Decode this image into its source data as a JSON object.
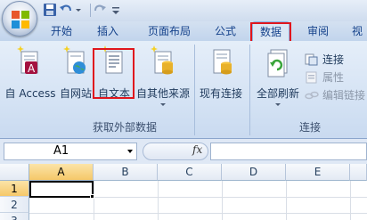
{
  "quick_access": {
    "save_icon": "save-icon",
    "undo_icon": "undo-icon",
    "redo_icon": "redo-icon",
    "customize_icon": "customize-qat-icon"
  },
  "tabs": [
    {
      "label": "开始"
    },
    {
      "label": "插入"
    },
    {
      "label": "页面布局"
    },
    {
      "label": "公式"
    },
    {
      "label": "数据",
      "active": true
    },
    {
      "label": "审阅"
    },
    {
      "label": "视"
    }
  ],
  "ribbon": {
    "get_external_data": {
      "label": "获取外部数据",
      "buttons": [
        {
          "label": "自 Access",
          "icon": "access-db-icon"
        },
        {
          "label": "自网站",
          "icon": "web-globe-icon"
        },
        {
          "label": "自文本",
          "icon": "text-file-icon",
          "highlighted": true
        },
        {
          "label": "自其他来源",
          "icon": "other-sources-icon"
        },
        {
          "label": "现有连接",
          "icon": "existing-connections-icon"
        }
      ]
    },
    "connections": {
      "label": "连接",
      "refresh_all": {
        "label": "全部刷新",
        "icon": "refresh-all-icon"
      },
      "items": [
        {
          "label": "连接",
          "icon": "connections-icon",
          "enabled": true
        },
        {
          "label": "属性",
          "icon": "properties-icon",
          "enabled": false
        },
        {
          "label": "编辑链接",
          "icon": "edit-links-icon",
          "enabled": false
        }
      ]
    }
  },
  "formula_bar": {
    "name_box": "A1",
    "fx_label": "fx",
    "formula": ""
  },
  "sheet": {
    "columns": [
      "A",
      "B",
      "C",
      "D",
      "E"
    ],
    "rows": [
      "1",
      "2",
      "3"
    ],
    "active_cell": "A1"
  },
  "colors": {
    "highlight": "#e0161d",
    "ribbon_bg": "#d5e3f4",
    "tab_text": "#15428b"
  }
}
